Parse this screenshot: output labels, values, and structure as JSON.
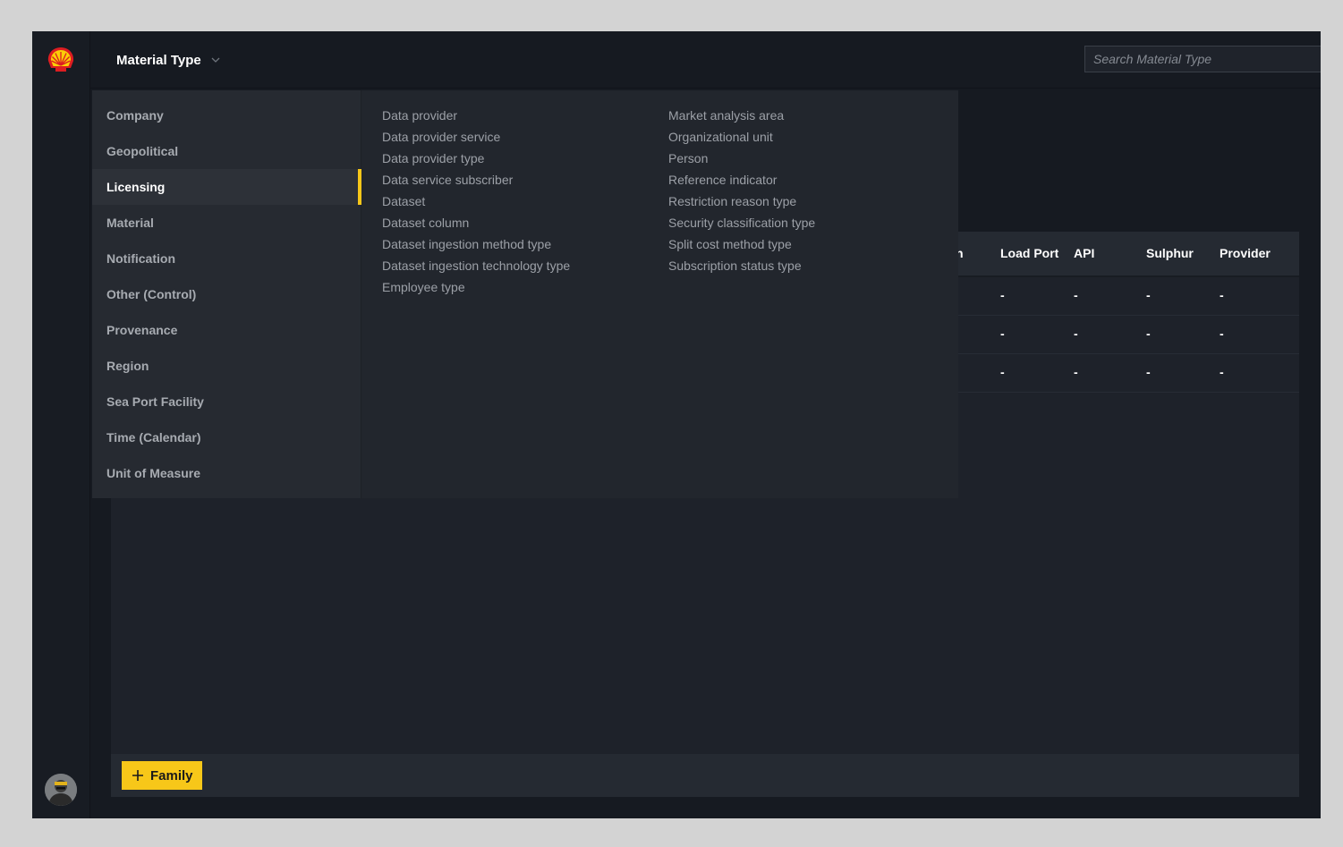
{
  "header": {
    "title": "Material Type",
    "search_placeholder": "Search Material Type"
  },
  "menu": {
    "categories": [
      {
        "label": "Company"
      },
      {
        "label": "Geopolitical"
      },
      {
        "label": "Licensing",
        "active": true
      },
      {
        "label": "Material"
      },
      {
        "label": "Notification"
      },
      {
        "label": "Other (Control)"
      },
      {
        "label": "Provenance"
      },
      {
        "label": "Region"
      },
      {
        "label": "Sea Port Facility"
      },
      {
        "label": "Time (Calendar)"
      },
      {
        "label": "Unit of Measure"
      }
    ],
    "column1": [
      "Data provider",
      "Data provider service",
      "Data provider type",
      "Data service subscriber",
      "Dataset",
      "Dataset column",
      "Dataset ingestion method type",
      "Dataset ingestion technology type",
      "Employee type"
    ],
    "column2": [
      "Market analysis area",
      "Organizational unit",
      "Person",
      "Reference indicator",
      "Restriction reason type",
      "Security classification type",
      "Split cost method type",
      "Subscription status type"
    ]
  },
  "table": {
    "partial_header": "n",
    "headers": [
      "Load Port",
      "API",
      "Sulphur",
      "Provider"
    ],
    "rows": [
      [
        "-",
        "-",
        "-",
        "-"
      ],
      [
        "-",
        "-",
        "-",
        "-"
      ],
      [
        "-",
        "-",
        "-",
        "-"
      ]
    ]
  },
  "footer": {
    "add_label": "Family"
  },
  "colors": {
    "accent": "#f7c719",
    "background": "#161a21",
    "panel": "#1e222a"
  }
}
